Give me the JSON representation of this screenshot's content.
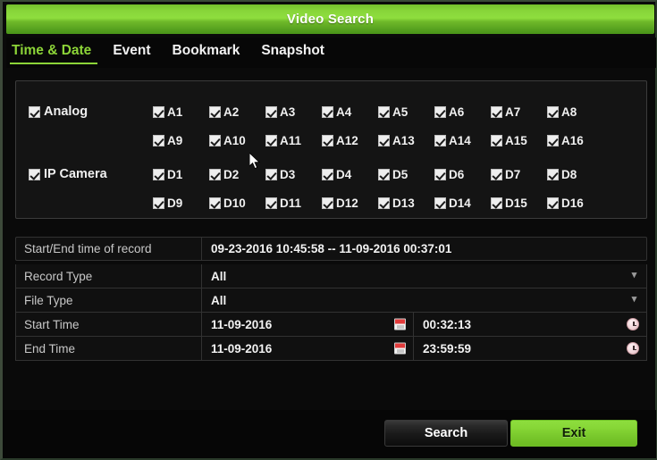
{
  "window": {
    "title": "Video Search",
    "accent_green": "#8ede3e",
    "background": "#0a0a0a"
  },
  "tabs": [
    {
      "label": "Time & Date",
      "active": true
    },
    {
      "label": "Event",
      "active": false
    },
    {
      "label": "Bookmark",
      "active": false
    },
    {
      "label": "Snapshot",
      "active": false
    }
  ],
  "channels": {
    "analog": {
      "label": "Analog",
      "checked": true,
      "row1": [
        {
          "label": "A1",
          "checked": true
        },
        {
          "label": "A2",
          "checked": true
        },
        {
          "label": "A3",
          "checked": true
        },
        {
          "label": "A4",
          "checked": true
        },
        {
          "label": "A5",
          "checked": true
        },
        {
          "label": "A6",
          "checked": true
        },
        {
          "label": "A7",
          "checked": true
        },
        {
          "label": "A8",
          "checked": true
        }
      ],
      "row2": [
        {
          "label": "A9",
          "checked": true
        },
        {
          "label": "A10",
          "checked": true
        },
        {
          "label": "A11",
          "checked": true
        },
        {
          "label": "A12",
          "checked": true
        },
        {
          "label": "A13",
          "checked": true
        },
        {
          "label": "A14",
          "checked": true
        },
        {
          "label": "A15",
          "checked": true
        },
        {
          "label": "A16",
          "checked": true
        }
      ]
    },
    "ip_camera": {
      "label": "IP Camera",
      "checked": true,
      "row1": [
        {
          "label": "D1",
          "checked": true
        },
        {
          "label": "D2",
          "checked": true
        },
        {
          "label": "D3",
          "checked": true
        },
        {
          "label": "D4",
          "checked": true
        },
        {
          "label": "D5",
          "checked": true
        },
        {
          "label": "D6",
          "checked": true
        },
        {
          "label": "D7",
          "checked": true
        },
        {
          "label": "D8",
          "checked": true
        }
      ],
      "row2": [
        {
          "label": "D9",
          "checked": true
        },
        {
          "label": "D10",
          "checked": true
        },
        {
          "label": "D11",
          "checked": true
        },
        {
          "label": "D12",
          "checked": true
        },
        {
          "label": "D13",
          "checked": true
        },
        {
          "label": "D14",
          "checked": true
        },
        {
          "label": "D15",
          "checked": true
        },
        {
          "label": "D16",
          "checked": true
        }
      ]
    }
  },
  "form": {
    "record_range": {
      "label": "Start/End time of record",
      "value": "09-23-2016 10:45:58 -- 11-09-2016 00:37:01"
    },
    "record_type": {
      "label": "Record Type",
      "value": "All"
    },
    "file_type": {
      "label": "File Type",
      "value": "All"
    },
    "start_time": {
      "label": "Start Time",
      "date": "11-09-2016",
      "time": "00:32:13"
    },
    "end_time": {
      "label": "End Time",
      "date": "11-09-2016",
      "time": "23:59:59"
    }
  },
  "footer": {
    "search_label": "Search",
    "exit_label": "Exit"
  }
}
